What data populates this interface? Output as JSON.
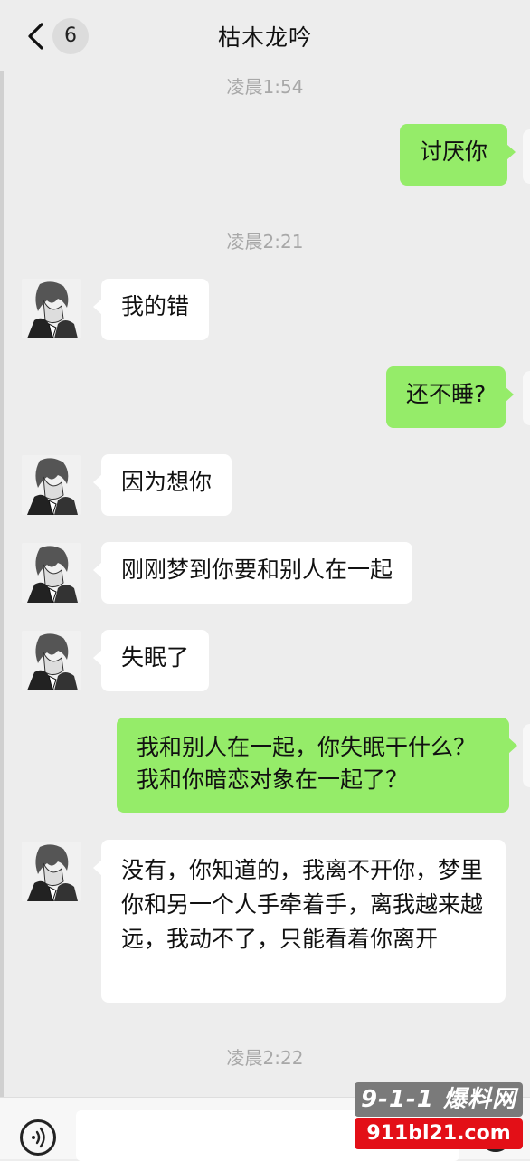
{
  "header": {
    "unread_count": "6",
    "title": "枯木龙吟"
  },
  "timestamps": {
    "t1": "凌晨1:54",
    "t2": "凌晨2:21",
    "t3": "凌晨2:22"
  },
  "messages": [
    {
      "side": "out",
      "text": "讨厌你"
    },
    {
      "side": "in",
      "text": "我的错"
    },
    {
      "side": "out",
      "text": "还不睡?"
    },
    {
      "side": "in",
      "text": "因为想你"
    },
    {
      "side": "in",
      "text": "刚刚梦到你要和别人在一起"
    },
    {
      "side": "in",
      "text": "失眠了"
    },
    {
      "side": "out",
      "text": "我和别人在一起，你失眠干什么？我和你暗恋对象在一起了？"
    },
    {
      "side": "in",
      "text": "没有，你知道的，我离不开你，梦里你和另一个人手牵着手，离我越来越远，我动不了，只能看着你离开"
    }
  ],
  "watermark": {
    "top": "9-1-1 爆料网",
    "bottom": "911bl21.com"
  },
  "colors": {
    "outgoing_bubble": "#95ec69",
    "incoming_bubble": "#ffffff",
    "background": "#ededed",
    "watermark_red": "#e30f17"
  },
  "icons": [
    "back-chevron-icon",
    "voice-icon",
    "emoji-icon"
  ]
}
